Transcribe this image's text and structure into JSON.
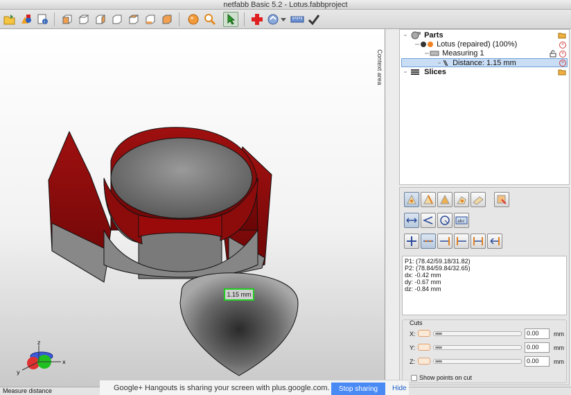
{
  "window": {
    "title": "netfabb Basic 5.2 - Lotus.fabbproject"
  },
  "toolbar": {
    "items": [
      "open-project",
      "add-part",
      "project-info",
      "view-front",
      "view-back",
      "view-left",
      "view-right",
      "view-top",
      "view-bottom",
      "zoom-sphere",
      "zoom",
      "select",
      "repair",
      "measure",
      "ruler",
      "apply"
    ]
  },
  "viewport": {
    "measure_label": "1.15 mm",
    "axis": {
      "x": "x",
      "y": "y",
      "z": "z"
    }
  },
  "status": {
    "text": "Measure distance"
  },
  "hangouts": {
    "message": "Google+ Hangouts is sharing your screen with plus.google.com.",
    "stop_label": "Stop sharing",
    "hide_label": "Hide"
  },
  "context_tab": "Context area",
  "tree": {
    "parts_label": "Parts",
    "part_label": "Lotus (repaired) (100%)",
    "measuring_label": "Measuring 1",
    "distance_label": "Distance: 1.15 mm",
    "slices_label": "Slices"
  },
  "measure_info": {
    "lines": [
      "P1: (78.42/59.18/31.82)",
      "P2: (78.84/59.84/32.65)",
      "dx: -0.42 mm",
      "dy: -0.67 mm",
      "dz: -0.84 mm"
    ]
  },
  "cuts": {
    "title": "Cuts",
    "rows": [
      {
        "axis": "X:",
        "value": "0.00",
        "unit": "mm"
      },
      {
        "axis": "Y:",
        "value": "0.00",
        "unit": "mm"
      },
      {
        "axis": "Z:",
        "value": "0.00",
        "unit": "mm"
      }
    ],
    "show_points_label": "Show points on cut"
  },
  "colors": {
    "model_red": "#8b0a0a",
    "model_gray": "#8a8a8a",
    "highlight_green": "#22cc22",
    "selection_blue": "#c9def5"
  }
}
